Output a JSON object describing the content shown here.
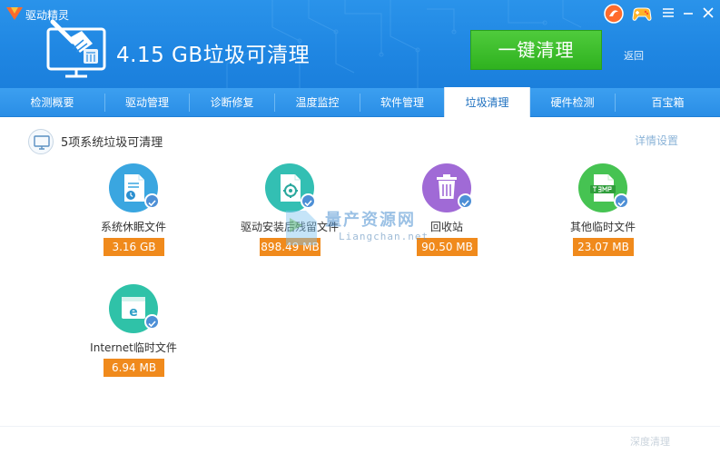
{
  "app": {
    "title": "驱动精灵"
  },
  "header": {
    "headline": "4.15 GB垃圾可清理",
    "clean_button": "一键清理",
    "back_link": "返回"
  },
  "tabs": [
    {
      "label": "检测概要"
    },
    {
      "label": "驱动管理"
    },
    {
      "label": "诊断修复"
    },
    {
      "label": "温度监控"
    },
    {
      "label": "软件管理"
    },
    {
      "label": "垃圾清理",
      "active": true
    },
    {
      "label": "硬件检测"
    },
    {
      "label": "百宝箱"
    }
  ],
  "section": {
    "title": "5项系统垃圾可清理",
    "settings_link": "详情设置"
  },
  "items": [
    {
      "label": "系统休眠文件",
      "size": "3.16 GB",
      "icon": "sleep-file-icon",
      "color": "#3aa6e0"
    },
    {
      "label": "驱动安装后残留文件",
      "size": "898.49 MB",
      "icon": "driver-residue-icon",
      "color": "#33bfb3"
    },
    {
      "label": "回收站",
      "size": "90.50 MB",
      "icon": "recycle-bin-icon",
      "color": "#a06ad6"
    },
    {
      "label": "其他临时文件",
      "size": "23.07 MB",
      "icon": "temp-file-icon",
      "color": "#46c352"
    },
    {
      "label": "Internet临时文件",
      "size": "6.94 MB",
      "icon": "ie-temp-icon",
      "color": "#2fc2a8"
    }
  ],
  "watermark": {
    "cn": "量产资源网",
    "en": "Liangchan.net"
  },
  "footer": {
    "deep_clean": "深度清理"
  },
  "colors": {
    "header_blue": "#1f86e2",
    "accent_green": "#35b525",
    "size_badge": "#f08a1c",
    "check_badge": "#4d8fd6"
  }
}
